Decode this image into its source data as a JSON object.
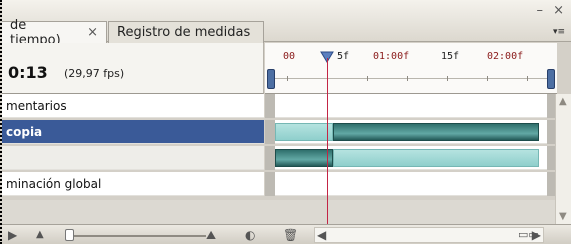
{
  "tabs": [
    {
      "label": "de tiempo)",
      "close": "×",
      "active": true
    },
    {
      "label": "Registro de medidas",
      "active": false
    }
  ],
  "window_controls": "– ×",
  "panel_menu": "▾≡",
  "timecode": "0:13",
  "fps": "(29,97 fps)",
  "ruler": {
    "labels": [
      "00",
      "5f",
      "01:00f",
      "15f",
      "02:00f"
    ]
  },
  "layers": [
    {
      "name": "mentarios",
      "selected": false
    },
    {
      "name": "copia",
      "selected": true
    },
    {
      "name": "",
      "selected": false
    },
    {
      "name": "minación global",
      "selected": false
    }
  ],
  "colors": {
    "selection": "#3a5a98",
    "playhead": "#c32545",
    "clip_light": "#a5dcd9",
    "clip_dark": "#3b817e"
  },
  "toolbar": {
    "icons": [
      "play-icon",
      "small-mountain-icon",
      "zoom-slider",
      "large-mountain-icon",
      "onion-skin-icon",
      "trash-icon",
      "scroll-left-icon",
      "scroll-right-icon",
      "frame-view-icon"
    ]
  }
}
